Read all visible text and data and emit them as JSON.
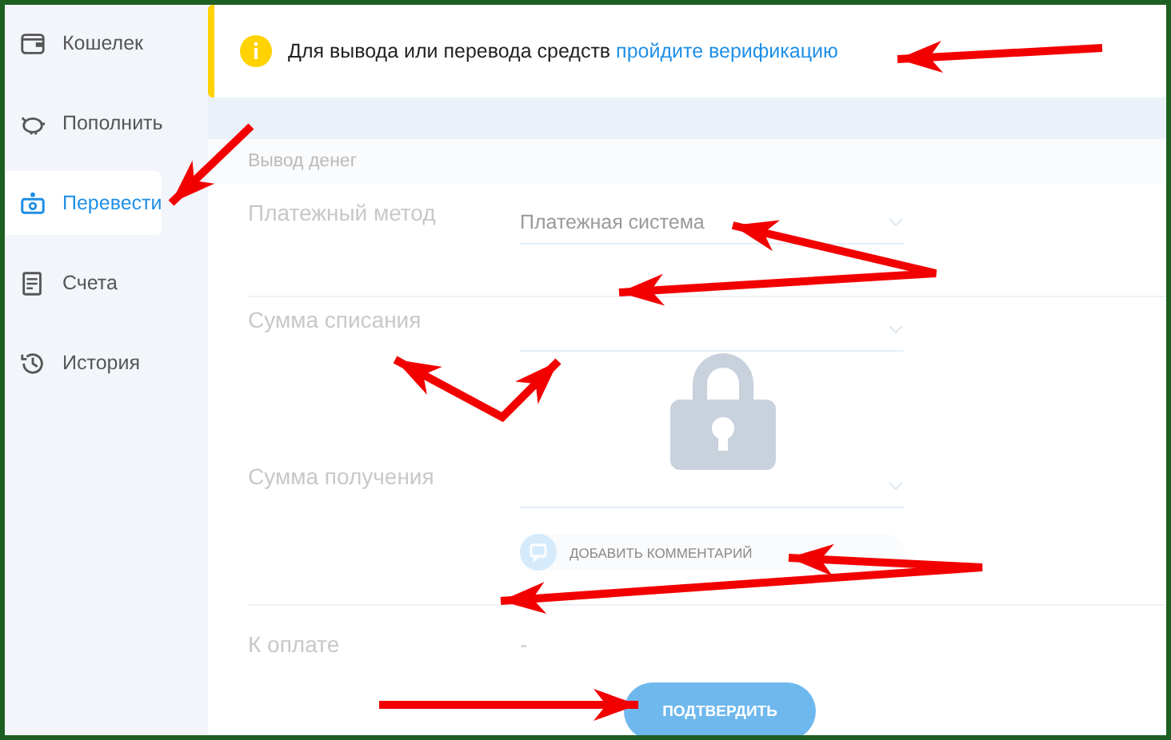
{
  "sidebar": {
    "items": [
      {
        "label": "Кошелек",
        "selected": false
      },
      {
        "label": "Пополнить",
        "selected": false
      },
      {
        "label": "Перевести",
        "selected": true
      },
      {
        "label": "Счета",
        "selected": false
      },
      {
        "label": "История",
        "selected": false
      }
    ]
  },
  "banner": {
    "text": "Для вывода или перевода средств",
    "link": "пройдите верификацию"
  },
  "form": {
    "title": "Вывод денег",
    "locked": true,
    "payment_method": {
      "label": "Платежный метод",
      "placeholder": "Платежная система"
    },
    "debit_amount": {
      "label": "Сумма списания"
    },
    "receive_amount": {
      "label": "Сумма получения"
    },
    "comment_button": "ДОБАВИТЬ КОММЕНТАРИЙ",
    "total": {
      "label": "К оплате",
      "value": "-"
    },
    "submit": "ПОДТВЕРДИТЬ"
  }
}
